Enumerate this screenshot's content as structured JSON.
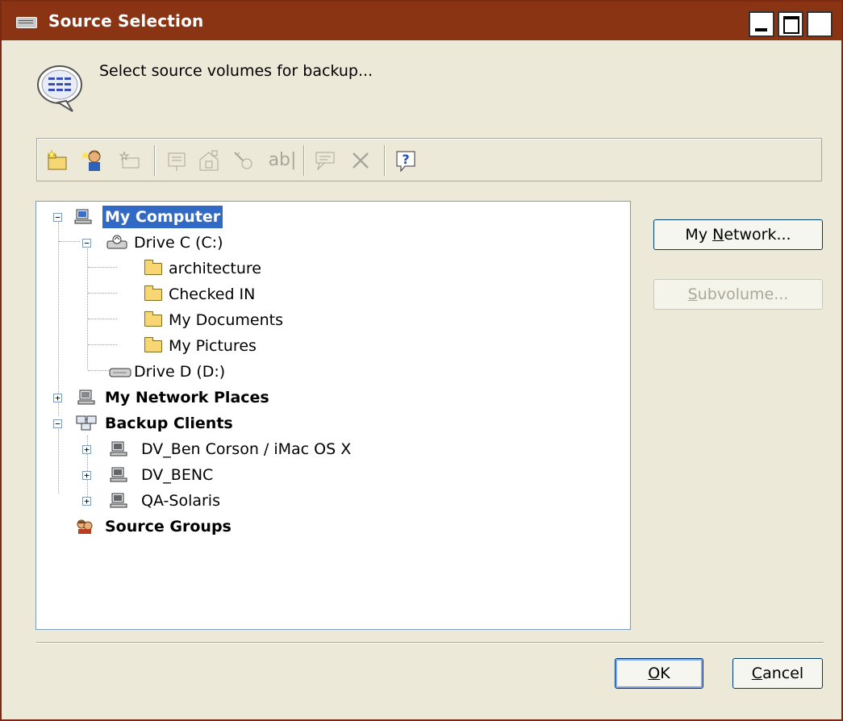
{
  "window": {
    "title": "Source Selection"
  },
  "header": {
    "prompt": "Select source volumes for backup..."
  },
  "toolbar": {
    "icons": [
      "new-folder-icon",
      "add-client-icon",
      "rename-icon",
      "properties-icon",
      "settings-icon",
      "key-icon",
      "text-ab-icon",
      "comment-icon",
      "delete-icon",
      "help-icon"
    ],
    "text_ab_label": "ab|",
    "help_label": "?"
  },
  "tree": {
    "my_computer": "My Computer",
    "drive_c": "Drive C (C:)",
    "folders": [
      "architecture",
      "Checked IN",
      "My Documents",
      "My Pictures"
    ],
    "drive_d": "Drive D (D:)",
    "my_network_places": "My Network Places",
    "backup_clients": "Backup Clients",
    "clients": [
      "DV_Ben Corson / iMac OS X",
      "DV_BENC",
      "QA-Solaris"
    ],
    "source_groups": "Source Groups"
  },
  "buttons": {
    "my_network_pre": "My ",
    "my_network_ul": "N",
    "my_network_post": "etwork...",
    "subvolume_ul": "S",
    "subvolume_post": "ubvolume...",
    "ok_ul": "O",
    "ok_post": "K",
    "cancel_ul": "C",
    "cancel_post": "ancel"
  },
  "colors": {
    "titlebar": "#8b3413",
    "selection": "#316ac5",
    "window_bg": "#ece9d8"
  }
}
